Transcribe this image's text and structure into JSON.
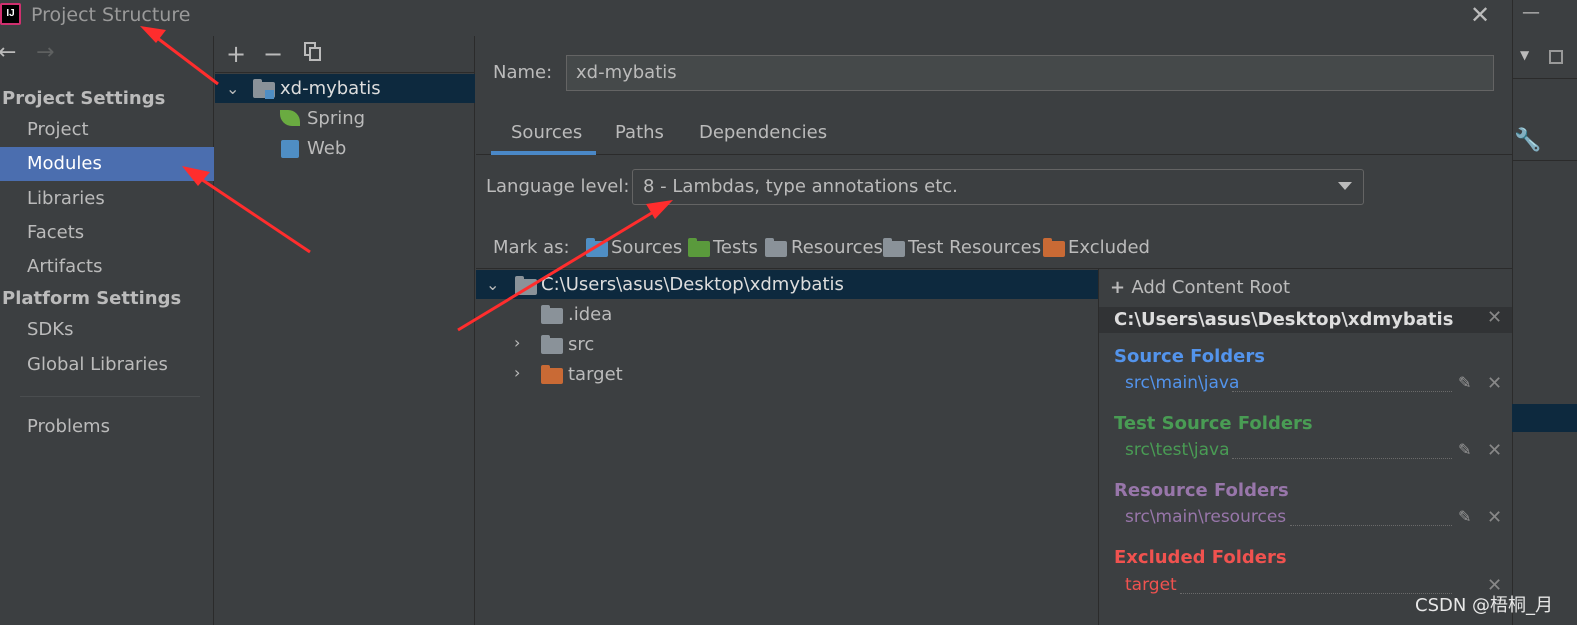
{
  "window": {
    "title": "Project Structure",
    "logo_text": "IJ",
    "close_glyph": "✕"
  },
  "nav": {
    "back_glyph": "←",
    "forward_glyph": "→",
    "project_settings_heading": "Project Settings",
    "project_settings_items": [
      "Project",
      "Modules",
      "Libraries",
      "Facets",
      "Artifacts"
    ],
    "platform_settings_heading": "Platform Settings",
    "platform_settings_items": [
      "SDKs",
      "Global Libraries"
    ],
    "problems": "Problems",
    "selected": "Modules"
  },
  "module_toolbar": {
    "add_glyph": "+",
    "remove_glyph": "−"
  },
  "module_tree": {
    "root": "xd-mybatis",
    "children": [
      "Spring",
      "Web"
    ]
  },
  "name_field": {
    "label": "Name:",
    "value": "xd-mybatis"
  },
  "tabs": [
    "Sources",
    "Paths",
    "Dependencies"
  ],
  "active_tab": "Sources",
  "language_level": {
    "label": "Language level:",
    "value": "8 - Lambdas, type annotations etc."
  },
  "mark_as": {
    "label": "Mark as:",
    "items": [
      "Sources",
      "Tests",
      "Resources",
      "Test Resources",
      "Excluded"
    ]
  },
  "content_tree": {
    "root": "C:\\Users\\asus\\Desktop\\xdmybatis",
    "children": [
      ".idea",
      "src",
      "target"
    ]
  },
  "roots_panel": {
    "add_content_root": "Add Content Root",
    "root_path": "C:\\Users\\asus\\Desktop\\xdmybatis",
    "sections": [
      {
        "title": "Source Folders",
        "path": "src\\main\\java",
        "color": "#5394ec"
      },
      {
        "title": "Test Source Folders",
        "path": "src\\test\\java",
        "color": "#499c54"
      },
      {
        "title": "Resource Folders",
        "path": "src\\main\\resources",
        "color": "#9876aa"
      },
      {
        "title": "Excluded Folders",
        "path": "target",
        "color": "#f0524f"
      }
    ]
  },
  "colors": {
    "selection": "#4b6eaf",
    "tree_selection": "#0d293e",
    "annotation": "#ff2d2d"
  },
  "watermark": "CSDN @梧桐_月"
}
